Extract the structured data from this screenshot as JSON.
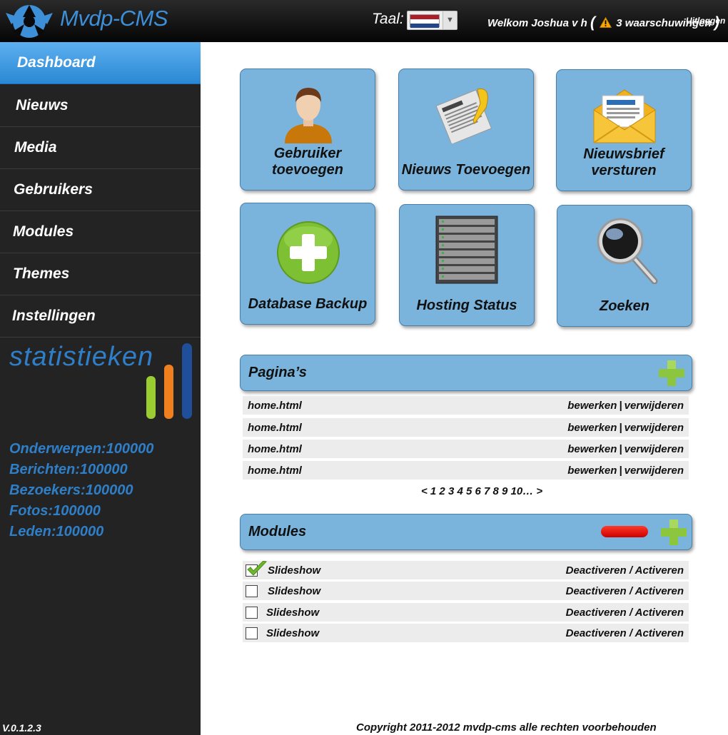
{
  "header": {
    "app_title": "Mvdp-CMS",
    "language_label": "Taal:",
    "language_selected": "Nederlands",
    "welcome_text": "Welkom Joshua v h",
    "paren_open": "(",
    "warnings_text": "3 waarschuwingen",
    "paren_close": ")",
    "logout_label": "Uitloggen"
  },
  "sidebar": {
    "items": [
      {
        "label": "Dashboard"
      },
      {
        "label": "Nieuws"
      },
      {
        "label": "Media"
      },
      {
        "label": "Gebruikers"
      },
      {
        "label": "Modules"
      },
      {
        "label": "Themes"
      },
      {
        "label": "Instellingen"
      }
    ],
    "stats_title": "statistieken",
    "stats": [
      "Onderwerpen:100000",
      "Berichten:100000",
      "Bezoekers:100000",
      "Fotos:100000",
      "Leden:100000"
    ],
    "version": "V.0.1.2.3"
  },
  "tiles": [
    {
      "label": "Gebruiker toevoegen",
      "icon": "user-icon"
    },
    {
      "label": "Nieuws Toevoegen",
      "icon": "news-icon"
    },
    {
      "label": "Nieuwsbrief versturen",
      "icon": "mail-icon"
    },
    {
      "label": "Database Backup",
      "icon": "plus-circle-icon"
    },
    {
      "label": "Hosting Status",
      "icon": "server-icon"
    },
    {
      "label": "Zoeken",
      "icon": "magnifier-icon"
    }
  ],
  "pages_panel": {
    "title": "Pagina’s",
    "rows": [
      {
        "name": "home.html",
        "edit": "bewerken",
        "sep": "|",
        "delete": "verwijderen"
      },
      {
        "name": "home.html",
        "edit": "bewerken",
        "sep": "|",
        "delete": "verwijderen"
      },
      {
        "name": "home.html",
        "edit": "bewerken",
        "sep": "|",
        "delete": "verwijderen"
      },
      {
        "name": "home.html",
        "edit": "bewerken",
        "sep": "|",
        "delete": "verwijderen"
      }
    ],
    "pagination": "< 1 2 3 4 5 6 7 8 9 10… >"
  },
  "modules_panel": {
    "title": "Modules",
    "rows": [
      {
        "name": "Slideshow",
        "action": "Deactiveren / Activeren",
        "checked": true
      },
      {
        "name": "Slideshow",
        "action": "Deactiveren / Activeren",
        "checked": false
      },
      {
        "name": "Slideshow",
        "action": "Deactiveren / Activeren",
        "checked": false
      },
      {
        "name": "Slideshow",
        "action": "Deactiveren / Activeren",
        "checked": false
      }
    ]
  },
  "footer": {
    "copyright": "Copyright 2011-2012 mvdp-cms alle rechten voorbehouden"
  },
  "colors": {
    "accent_blue": "#2f7fc8",
    "tile_blue": "#7ab4dc",
    "sidebar_bg": "#232323",
    "plus_green": "#8cc63f",
    "minus_red": "#e01b0f"
  }
}
